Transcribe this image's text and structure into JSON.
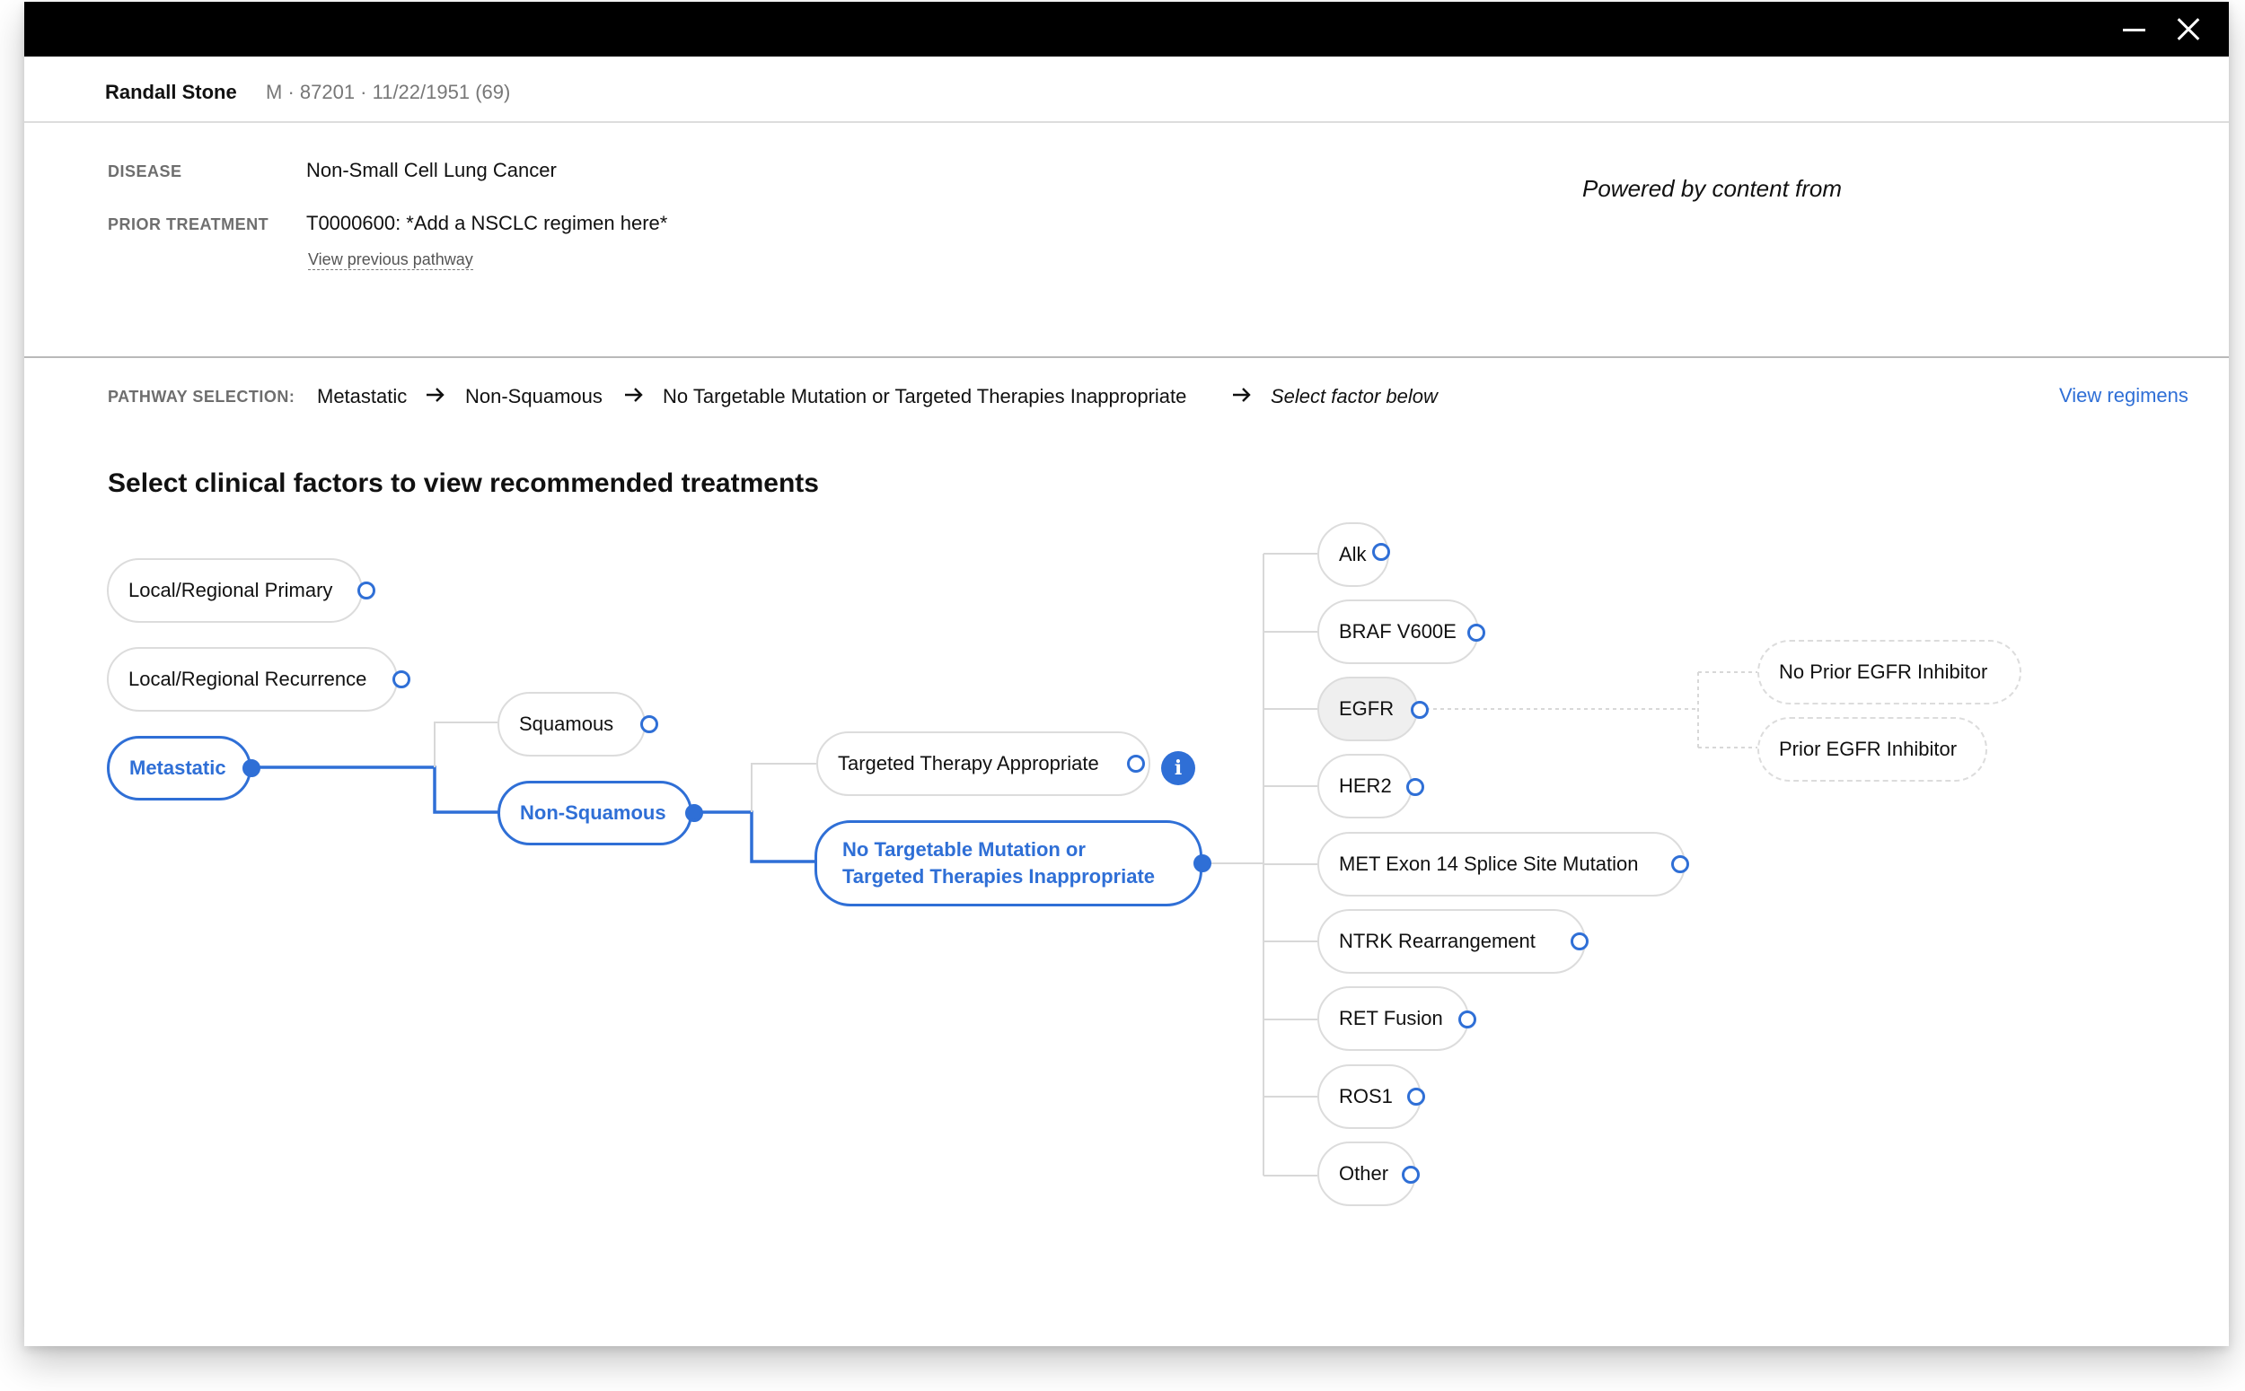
{
  "window": {
    "minimize_label": "",
    "close_label": ""
  },
  "patient": {
    "name": "Randall Stone",
    "meta": "M · 87201 · 11/22/1951 (69)"
  },
  "info": {
    "disease_label": "DISEASE",
    "disease_value": "Non-Small Cell Lung Cancer",
    "prior_label": "PRIOR TREATMENT",
    "prior_value": "T0000600: *Add a NSCLC regimen here*",
    "view_previous": "View previous pathway",
    "powered_by": "Powered by content from"
  },
  "pathway": {
    "label": "PATHWAY SELECTION:",
    "crumbs": [
      "Metastatic",
      "Non-Squamous",
      "No Targetable Mutation or Targeted Therapies Inappropriate",
      "Select factor below"
    ],
    "view_regimens": "View regimens"
  },
  "section_title": "Select clinical factors to view recommended treatments",
  "tree": {
    "level1": [
      "Local/Regional Primary",
      "Local/Regional Recurrence",
      "Metastatic"
    ],
    "level2": [
      "Squamous",
      "Non-Squamous"
    ],
    "level3": [
      "Targeted Therapy Appropriate",
      "No Targetable Mutation or",
      "Targeted Therapies Inappropriate"
    ],
    "level4": [
      "Alk",
      "BRAF V600E",
      "EGFR",
      "HER2",
      "MET Exon 14 Splice Site Mutation",
      "NTRK Rearrangement",
      "RET Fusion",
      "ROS1",
      "Other"
    ],
    "level5": [
      "No Prior EGFR Inhibitor",
      "Prior EGFR Inhibitor"
    ],
    "info_glyph": "i"
  },
  "colors": {
    "accent": "#2f6fd6",
    "titlebar": "#000000",
    "pill_border": "#dcdcdc"
  }
}
